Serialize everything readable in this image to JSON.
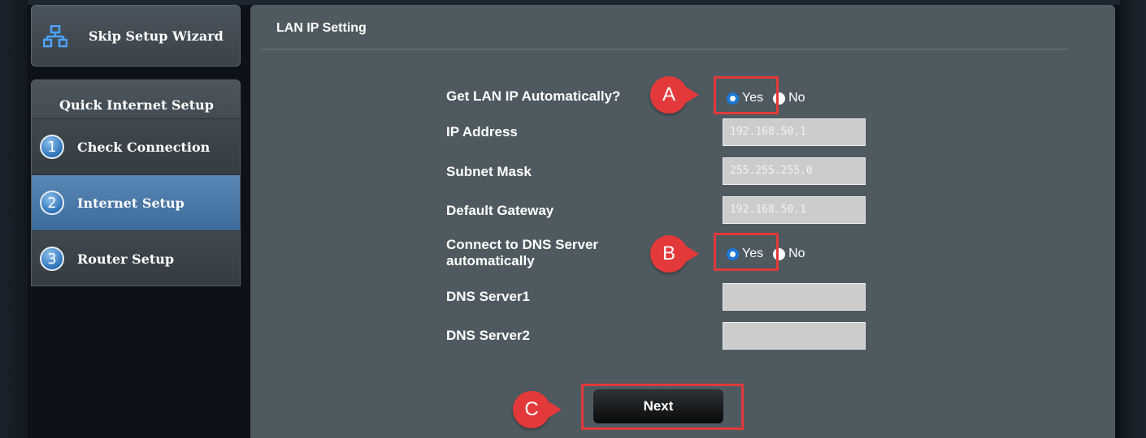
{
  "sidebar": {
    "skip_wizard_label": "Skip Setup Wizard",
    "qis_title": "Quick Internet Setup",
    "steps": [
      {
        "number": "1",
        "label": "Check Connection",
        "active": false
      },
      {
        "number": "2",
        "label": "Internet Setup",
        "active": true
      },
      {
        "number": "3",
        "label": "Router Setup",
        "active": false
      }
    ]
  },
  "main": {
    "title": "LAN IP Setting",
    "fields": {
      "get_lan_ip_label": "Get LAN IP Automatically?",
      "get_lan_ip_yes": "Yes",
      "get_lan_ip_no": "No",
      "get_lan_ip_selected": "Yes",
      "ip_address_label": "IP Address",
      "ip_address_value": "192.168.50.1",
      "subnet_mask_label": "Subnet Mask",
      "subnet_mask_value": "255.255.255.0",
      "default_gateway_label": "Default Gateway",
      "default_gateway_value": "192.168.50.1",
      "dns_auto_label_line1": "Connect to DNS Server",
      "dns_auto_label_line2": "automatically",
      "dns_auto_yes": "Yes",
      "dns_auto_no": "No",
      "dns_auto_selected": "Yes",
      "dns1_label": "DNS Server1",
      "dns1_value": "",
      "dns2_label": "DNS Server2",
      "dns2_value": ""
    },
    "next_label": "Next"
  },
  "annotations": {
    "callout_a": "A",
    "callout_b": "B",
    "callout_c": "C"
  },
  "colors": {
    "panel_bg": "#4e5a5f",
    "active_step": "#4a78a8",
    "highlight_red": "#e23a3a",
    "radio_blue": "#1f77d6"
  },
  "icons": {
    "skip_wizard": "network-icon"
  }
}
